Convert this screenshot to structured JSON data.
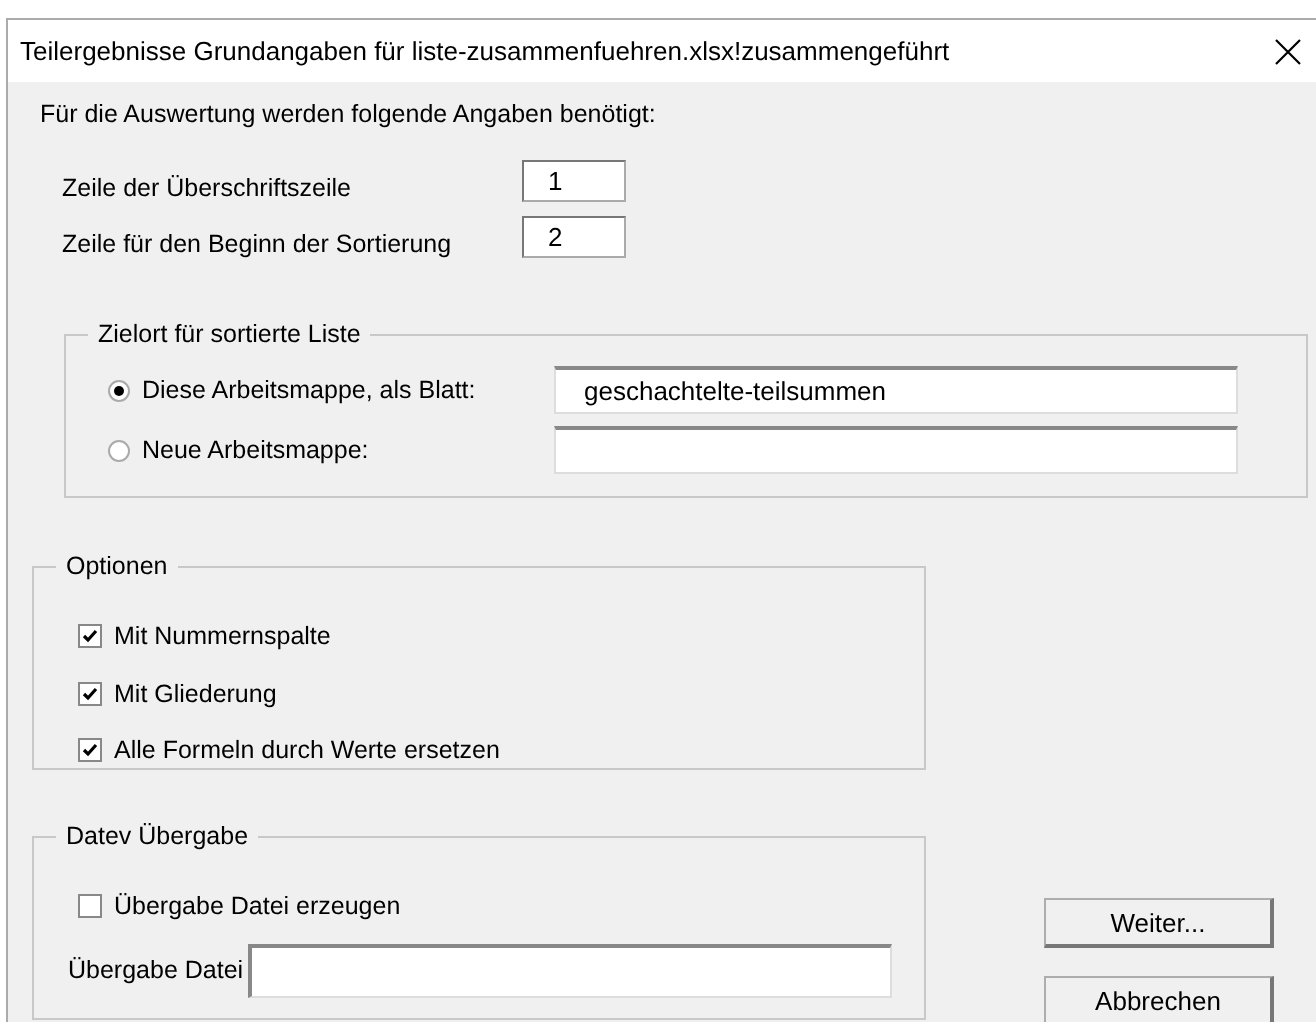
{
  "window": {
    "title": "Teilergebnisse Grundangaben für liste-zusammenfuehren.xlsx!zusammengeführt"
  },
  "intro": "Für die Auswertung werden folgende Angaben benötigt:",
  "header_fields": [
    {
      "label": "Zeile der Überschriftszeile",
      "value": "1"
    },
    {
      "label": "Zeile für den Beginn der Sortierung",
      "value": "2"
    }
  ],
  "target_group": {
    "title": "Zielort für sortierte Liste",
    "options": [
      {
        "label": "Diese Arbeitsmappe, als Blatt:",
        "selected": true,
        "value": "geschachtelte-teilsummen"
      },
      {
        "label": "Neue Arbeitsmappe:",
        "selected": false
      }
    ]
  },
  "options_group": {
    "title": "Optionen",
    "items": [
      {
        "label": "Mit Nummernspalte",
        "checked": true
      },
      {
        "label": "Mit Gliederung",
        "checked": true
      },
      {
        "label": "Alle Formeln durch Werte ersetzen",
        "checked": true
      }
    ]
  },
  "datev_group": {
    "title": "Datev Übergabe",
    "items": [
      {
        "label": "Übergabe Datei erzeugen",
        "checked": false
      }
    ],
    "file_label": "Übergabe Datei"
  },
  "buttons": [
    "Weiter...",
    "Abbrechen"
  ]
}
